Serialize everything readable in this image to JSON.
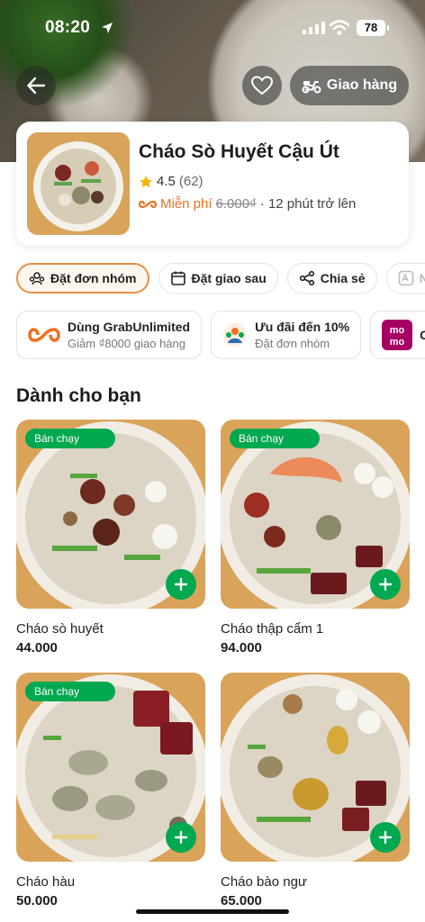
{
  "status_bar": {
    "time": "08:20",
    "battery": "78"
  },
  "header": {
    "delivery_label": "Giao hàng"
  },
  "restaurant": {
    "name": "Cháo Sò Huyết Cậu Út",
    "rating": "4.5",
    "rating_count": "(62)",
    "free_label": "Miễn phí",
    "old_fee": "6.000₫",
    "eta": "· 12 phút trở lên"
  },
  "actions": [
    {
      "label": "Đặt đơn nhóm",
      "icon": "group-icon"
    },
    {
      "label": "Đặt giao sau",
      "icon": "calendar-icon"
    },
    {
      "label": "Chia sẻ",
      "icon": "share-icon"
    },
    {
      "label": "N",
      "icon": "translate-icon"
    }
  ],
  "offers": [
    {
      "title": "Dùng GrabUnlimited",
      "subtitle": "Giảm ₫8000 giao hàng",
      "icon": "grab-unlimited-icon"
    },
    {
      "title": "Ưu đãi đến 10%",
      "subtitle": "Đặt đơn nhóm",
      "icon": "group-offer-icon"
    },
    {
      "title": "G",
      "subtitle": "",
      "icon": "momo-icon"
    }
  ],
  "section_title": "Dành cho bạn",
  "dishes": [
    {
      "name": "Cháo sò huyết",
      "price": "44.000",
      "badge": "Bán chạy"
    },
    {
      "name": "Cháo thập cẩm 1",
      "price": "94.000",
      "badge": "Bán chạy"
    },
    {
      "name": "Cháo hàu",
      "price": "50.000",
      "badge": "Bán chạy"
    },
    {
      "name": "Cháo bào ngư",
      "price": "65.000",
      "badge": ""
    }
  ],
  "colors": {
    "brand_green": "#00a84f",
    "promo_orange": "#f26f21",
    "chip_active_border": "#e8913e"
  }
}
